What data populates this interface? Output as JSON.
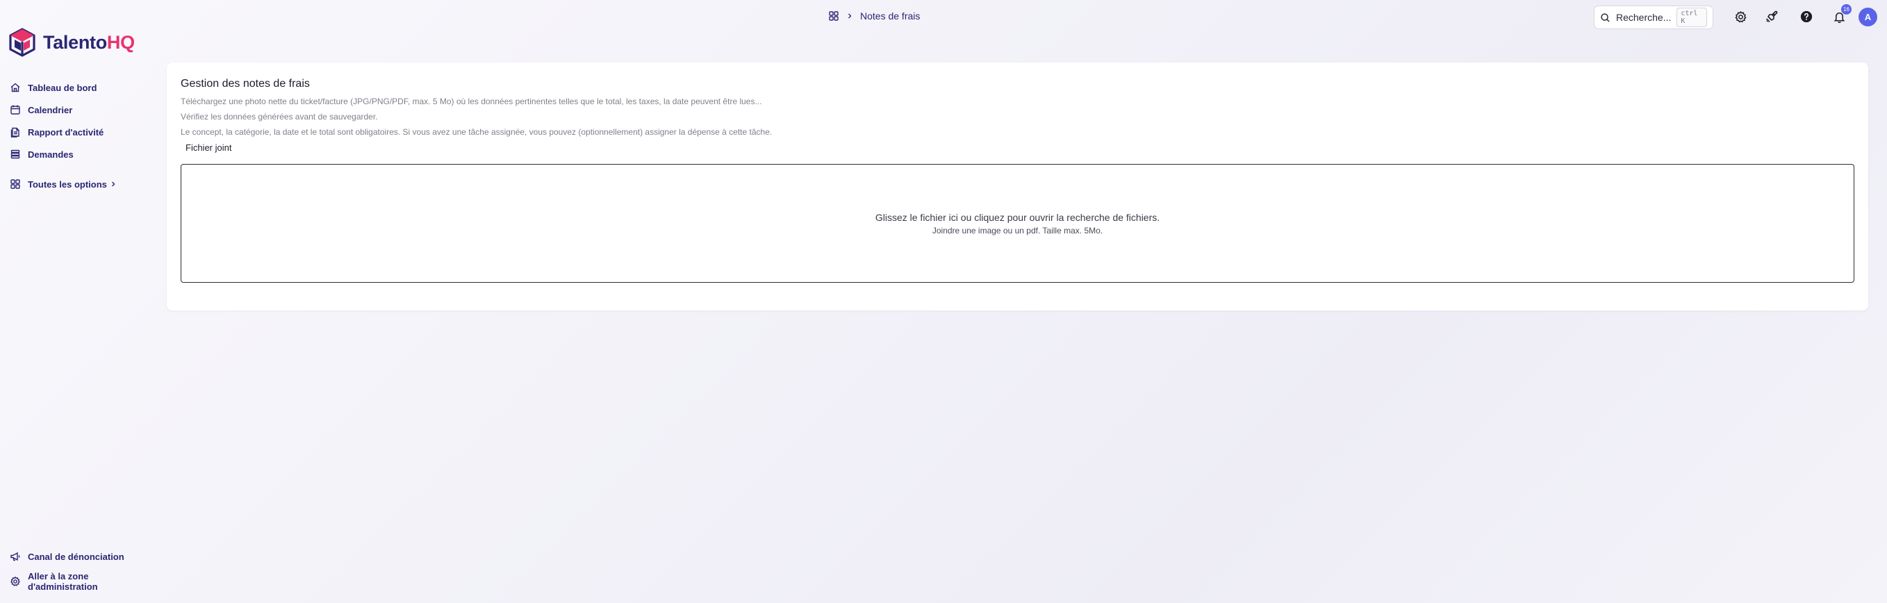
{
  "app": {
    "logo_primary": "Talento",
    "logo_accent": "HQ",
    "brand_color": "#2a2672",
    "accent_color": "#e8336b"
  },
  "sidebar": {
    "items": [
      {
        "label": "Tableau de bord",
        "icon": "home-icon"
      },
      {
        "label": "Calendrier",
        "icon": "calendar-icon"
      },
      {
        "label": "Rapport d'activité",
        "icon": "report-icon"
      },
      {
        "label": "Demandes",
        "icon": "stack-icon"
      }
    ],
    "all_options": {
      "label": "Toutes les options",
      "icon": "grid-icon"
    },
    "bottom": [
      {
        "label": "Canal de dénonciation",
        "icon": "megaphone-icon"
      },
      {
        "label": "Aller à la zone d'administration",
        "icon": "gear-icon"
      }
    ]
  },
  "header": {
    "breadcrumb": {
      "current": "Notes de frais"
    },
    "search": {
      "placeholder": "Recherche...",
      "shortcut": "ctrl K"
    },
    "notifications_count": "16",
    "avatar_initial": "A"
  },
  "main": {
    "title": "Gestion des notes de frais",
    "instructions": [
      "Téléchargez une photo nette du ticket/facture (JPG/PNG/PDF, max. 5 Mo) où les données pertinentes telles que le total, les taxes, la date peuvent être lues...",
      "Vérifiez les données générées avant de sauvegarder.",
      "Le concept, la catégorie, la date et le total sont obligatoires. Si vous avez une tâche assignée, vous pouvez (optionnellement) assigner la dépense à cette tâche."
    ],
    "field_label": "Fichier joint",
    "dropzone": {
      "main": "Glissez le fichier ici ou cliquez pour ouvrir la recherche de fichiers.",
      "sub": "Joindre une image ou un pdf. Taille max. 5Mo."
    }
  }
}
